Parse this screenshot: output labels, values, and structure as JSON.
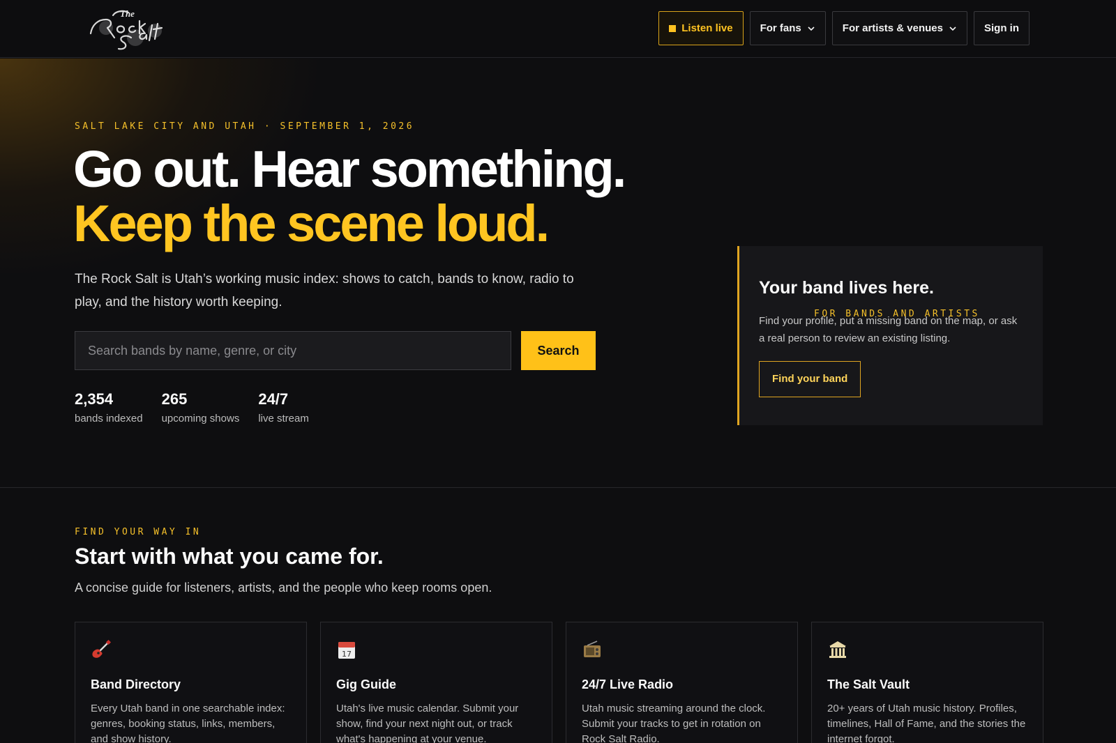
{
  "nav": {
    "listen_live": "Listen live",
    "for_fans": "For fans",
    "for_artists": "For artists & venues",
    "sign_in": "Sign in"
  },
  "hero": {
    "eyebrow": "SALT LAKE CITY AND UTAH · SEPTEMBER 1, 2026",
    "headline_1": "Go out. Hear something.",
    "headline_2": "Keep the scene loud.",
    "description": "The Rock Salt is Utah’s working music index: shows to catch, bands to know, radio to play, and the history worth keeping.",
    "search_placeholder": "Search bands by name, genre, or city",
    "search_button": "Search",
    "stats": [
      {
        "value": "2,354",
        "label": "bands indexed"
      },
      {
        "value": "265",
        "label": "upcoming shows"
      },
      {
        "value": "24/7",
        "label": "live stream"
      }
    ]
  },
  "band_card": {
    "eyebrow": "FOR BANDS AND ARTISTS",
    "title": "Your band lives here.",
    "text": "Find your profile, put a missing band on the map, or ask a real person to review an existing listing.",
    "button": "Find your band"
  },
  "section": {
    "eyebrow": "FIND YOUR WAY IN",
    "title": "Start with what you came for.",
    "subtitle": "A concise guide for listeners, artists, and the people who keep rooms open.",
    "cards": [
      {
        "icon": "guitar-icon",
        "title": "Band Directory",
        "text": "Every Utah band in one searchable index: genres, booking status, links, members, and show history."
      },
      {
        "icon": "calendar-icon",
        "title": "Gig Guide",
        "text": "Utah's live music calendar. Submit your show, find your next night out, or track what's happening at your venue."
      },
      {
        "icon": "radio-icon",
        "title": "24/7 Live Radio",
        "text": "Utah music streaming around the clock. Submit your tracks to get in rotation on Rock Salt Radio."
      },
      {
        "icon": "museum-icon",
        "title": "The Salt Vault",
        "text": "20+ years of Utah music history. Profiles, timelines, Hall of Fame, and the stories the internet forgot."
      }
    ]
  },
  "colors": {
    "accent": "#ffc118",
    "background": "#0e0e10",
    "card_border": "#e0a521"
  }
}
